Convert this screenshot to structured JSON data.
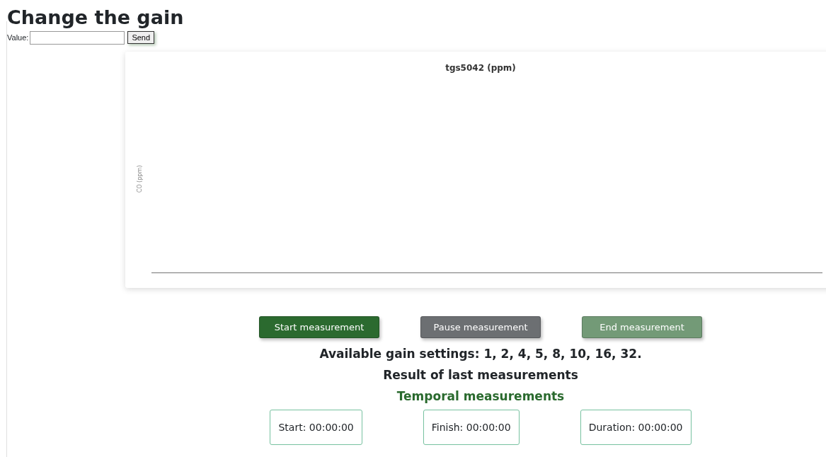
{
  "heading": "Change the gain",
  "gain_form": {
    "label": "Value:",
    "button": "Send"
  },
  "chart": {
    "title": "tgs5042 (ppm)",
    "ylabel": "CO (ppm)"
  },
  "buttons": [
    {
      "label": "Start measurement",
      "kind": "start"
    },
    {
      "label": "Pause measurement",
      "kind": "pause"
    },
    {
      "label": "End measurement",
      "kind": "end"
    }
  ],
  "gain_settings": "Available gain settings: 1, 2, 4, 5, 8, 10, 16, 32.",
  "results_title": "Result of last measurements",
  "temporal_title": "Temporal measurements",
  "times": [
    "Start: 00:00:00",
    "Finish: 00:00:00",
    "Duration: 00:00:00"
  ]
}
